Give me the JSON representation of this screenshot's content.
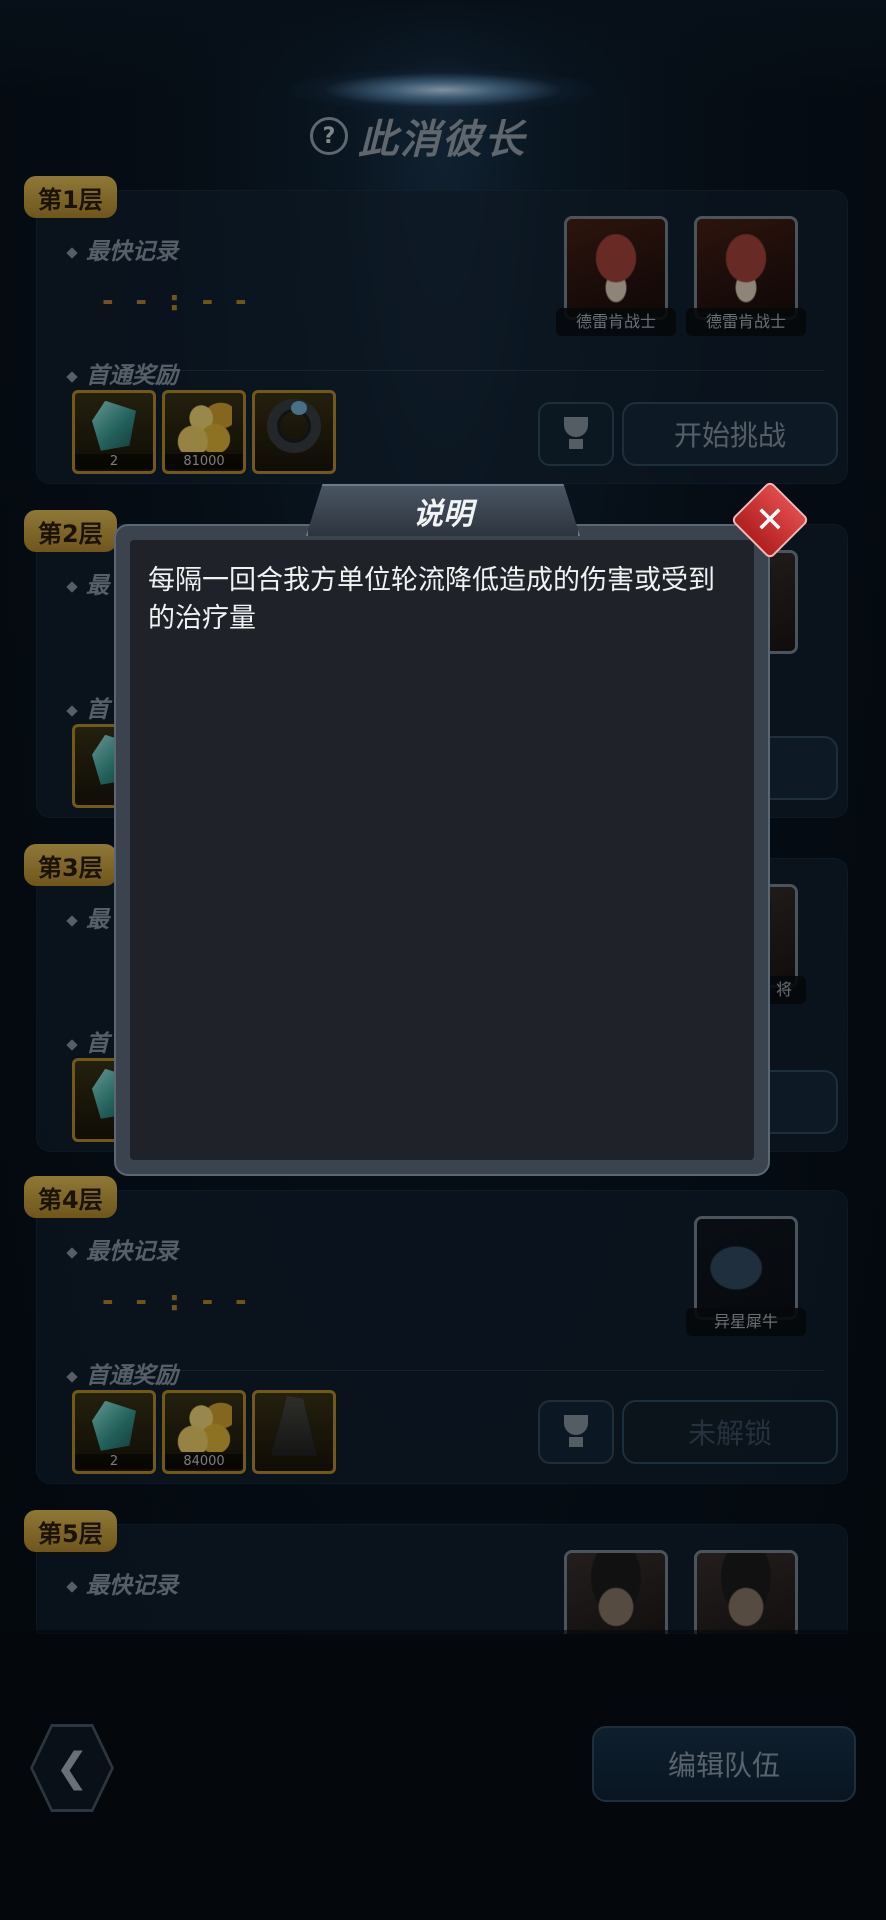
{
  "header": {
    "title": "此消彼长",
    "help_icon": "question-circle-icon"
  },
  "floors": [
    {
      "tag": "第1层",
      "record_label": "最快记录",
      "record_value": "- - : - -",
      "reward_label": "首通奖励",
      "rewards": [
        {
          "icon": "gem-icon",
          "amount": "2"
        },
        {
          "icon": "coins-icon",
          "amount": "81000"
        },
        {
          "icon": "ring-icon",
          "amount": ""
        }
      ],
      "enemies": [
        "德雷肯战士",
        "德雷肯战士"
      ],
      "action": "开始挑战"
    },
    {
      "tag": "第2层",
      "record_label": "最",
      "reward_label": "首"
    },
    {
      "tag": "第3层",
      "record_label": "最",
      "reward_label": "首",
      "enemy_partial": "将"
    },
    {
      "tag": "第4层",
      "record_label": "最快记录",
      "record_value": "- - : - -",
      "reward_label": "首通奖励",
      "rewards": [
        {
          "icon": "gem-icon",
          "amount": "2"
        },
        {
          "icon": "coins-icon",
          "amount": "84000"
        },
        {
          "icon": "statue-icon",
          "amount": ""
        }
      ],
      "enemies": [
        "异星犀牛"
      ],
      "action": "未解锁"
    },
    {
      "tag": "第5层",
      "record_label": "最快记录"
    }
  ],
  "dialog": {
    "title": "说明",
    "text": "每隔一回合我方单位轮流降低造成的伤害或受到的治疗量",
    "close_icon": "close-icon"
  },
  "footer": {
    "back_icon": "chevron-left-icon",
    "edit_team": "编辑队伍"
  }
}
